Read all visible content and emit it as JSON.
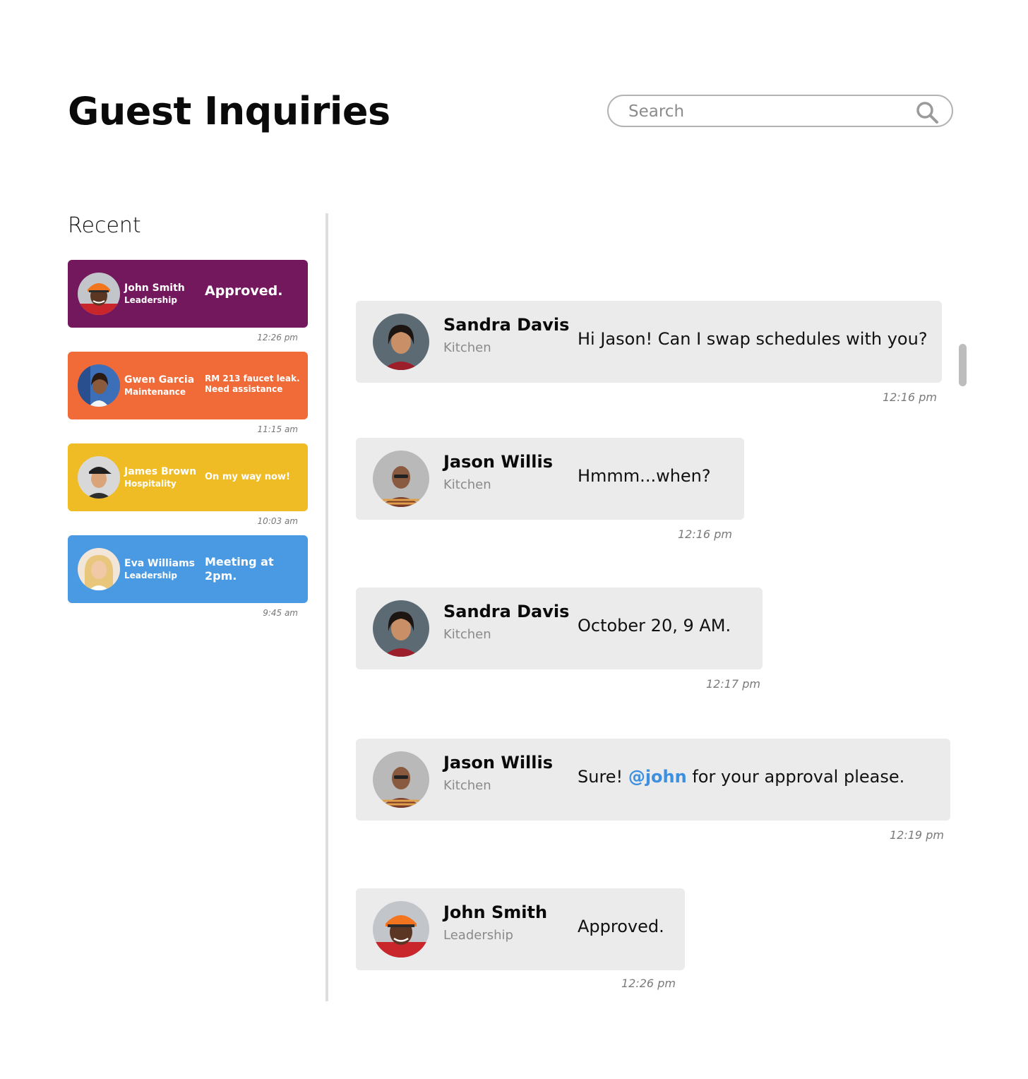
{
  "header": {
    "title": "Guest Inquiries",
    "search_placeholder": "Search"
  },
  "recent": {
    "label": "Recent",
    "items": [
      {
        "name": "John Smith",
        "dept": "Leadership",
        "message": "Approved.",
        "time": "12:26 pm",
        "color": "#74185e"
      },
      {
        "name": "Gwen Garcia",
        "dept": "Maintenance",
        "message": "RM 213 faucet leak. Need assistance",
        "time": "11:15 am",
        "color": "#f16b38"
      },
      {
        "name": "James Brown",
        "dept": "Hospitality",
        "message": "On my way now!",
        "time": "10:03 am",
        "color": "#efbc25"
      },
      {
        "name": "Eva Williams",
        "dept": "Leadership",
        "message": "Meeting at 2pm.",
        "time": "9:45 am",
        "color": "#4a9ae3"
      }
    ]
  },
  "chat": {
    "messages": [
      {
        "name": "Sandra Davis",
        "dept": "Kitchen",
        "text": "Hi Jason! Can I swap schedules with you?",
        "time": "12:16 pm"
      },
      {
        "name": "Jason Willis",
        "dept": "Kitchen",
        "text": "Hmmm...when?",
        "time": "12:16 pm"
      },
      {
        "name": "Sandra Davis",
        "dept": "Kitchen",
        "text": "October 20, 9 AM.",
        "time": "12:17 pm"
      },
      {
        "name": "Jason Willis",
        "dept": "Kitchen",
        "text_before": "Sure! ",
        "mention": "@john",
        "text_after": " for your approval please.",
        "time": "12:19 pm"
      },
      {
        "name": "John Smith",
        "dept": "Leadership",
        "text": "Approved.",
        "time": "12:26 pm"
      }
    ]
  },
  "colors": {
    "mention": "#3d8fe0",
    "bubble_bg": "#ebebeb"
  }
}
